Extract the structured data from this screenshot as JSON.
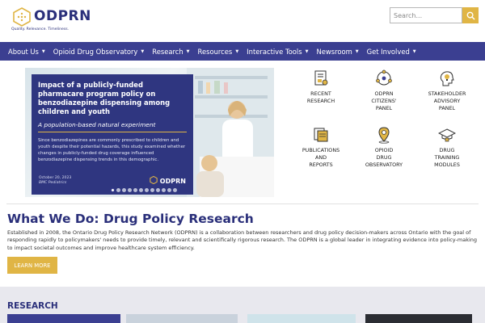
{
  "brand": {
    "name": "ODPRN",
    "tagline": "Quality. Relevance. Timeliness.",
    "colors": {
      "primary": "#3b3f91",
      "accent": "#e0b545",
      "heading": "#2a2f7a"
    }
  },
  "search": {
    "placeholder": "Search...",
    "icon": "search-icon"
  },
  "nav": [
    {
      "label": "About Us"
    },
    {
      "label": "Opioid Drug Observatory"
    },
    {
      "label": "Research"
    },
    {
      "label": "Resources"
    },
    {
      "label": "Interactive Tools"
    },
    {
      "label": "Newsroom"
    },
    {
      "label": "Get Involved"
    }
  ],
  "hero": {
    "title": "Impact of a publicly-funded pharmacare program policy on benzodiazepine dispensing among children and youth",
    "subtitle": "A population-based natural experiment",
    "body": "Since benzodiazepines are commonly prescribed to children and youth despite their potential hazards, this study examined whether changes in publicly-funded drug coverage influenced benzodiazepine dispensing trends in this demographic.",
    "date": "October 20, 2023",
    "journal": "BMC Pediatrics",
    "logo_text": "ODPRN",
    "slides_total": 12,
    "slide_active": 1
  },
  "quick_links": [
    {
      "label_lines": [
        "RECENT",
        "RESEARCH"
      ],
      "icon": "document-icon"
    },
    {
      "label_lines": [
        "ODPRN",
        "CITIZENS'",
        "PANEL"
      ],
      "icon": "citizens-icon"
    },
    {
      "label_lines": [
        "STAKEHOLDER",
        "ADVISORY",
        "PANEL"
      ],
      "icon": "lightbulb-head-icon"
    },
    {
      "label_lines": [
        "PUBLICATIONS",
        "AND",
        "REPORTS"
      ],
      "icon": "publications-icon"
    },
    {
      "label_lines": [
        "OPIOID",
        "DRUG",
        "OBSERVATORY"
      ],
      "icon": "location-pin-icon"
    },
    {
      "label_lines": [
        "DRUG",
        "TRAINING",
        "MODULES"
      ],
      "icon": "graduation-cap-icon"
    }
  ],
  "what_we_do": {
    "title": "What We Do: Drug Policy Research",
    "body": "Established in 2008, the Ontario Drug Policy Research Network (ODPRN) is a collaboration between researchers and drug policy decision-makers across Ontario with the goal of responding rapidly to policymakers' needs to provide timely, relevant and scientifically rigorous research. The ODPRN is a global leader in integrating evidence into policy-making to impact societal outcomes and improve healthcare system efficiency.",
    "button_label": "LEARN MORE"
  },
  "research": {
    "title": "RESEARCH"
  }
}
